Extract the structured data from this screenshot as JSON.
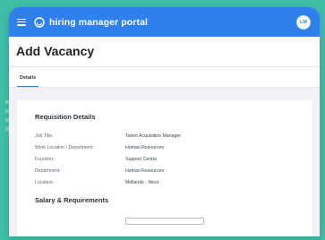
{
  "appbar": {
    "title": "hiring manager portal",
    "avatar_initials": "LM",
    "icons": [
      "menu-icon",
      "logo-icon"
    ]
  },
  "page": {
    "title": "Add Vacancy"
  },
  "tabs": [
    {
      "label": "Details",
      "active": true
    }
  ],
  "requisition": {
    "heading": "Requisition Details",
    "rows": [
      {
        "label": "Job Title:",
        "value": "Talent Acquisition Manager"
      },
      {
        "label": "Work Location / Department:",
        "value": "Human Resources"
      },
      {
        "label": "Function:",
        "value": "Support Centre"
      },
      {
        "label": "Department:",
        "value": "Human Resources"
      },
      {
        "label": "Location:",
        "value": "Midlands - West"
      }
    ]
  },
  "salary": {
    "heading": "Salary & Requirements"
  },
  "colors": {
    "background": "#3fbfa8",
    "appbar": "#2f80ed",
    "accent": "#2f80ed"
  }
}
